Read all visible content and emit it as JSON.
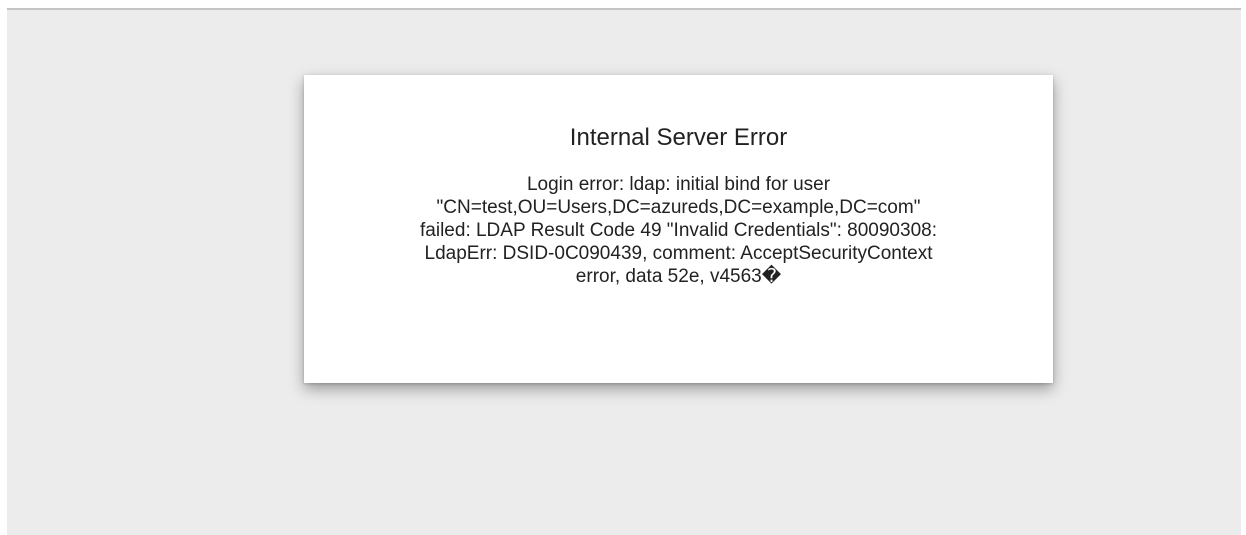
{
  "error": {
    "title": "Internal Server Error",
    "message_lines": [
      "Login error: ldap: initial bind for user",
      "\"CN=test,OU=Users,DC=azureds,DC=example,DC=com\"",
      "failed: LDAP Result Code 49 \"Invalid Credentials\": 80090308:",
      "LdapErr: DSID-0C090439, comment: AcceptSecurityContext",
      "error, data 52e, v4563�"
    ]
  },
  "colors": {
    "page_background": "#ececec",
    "card_background": "#ffffff",
    "text": "#222222"
  }
}
